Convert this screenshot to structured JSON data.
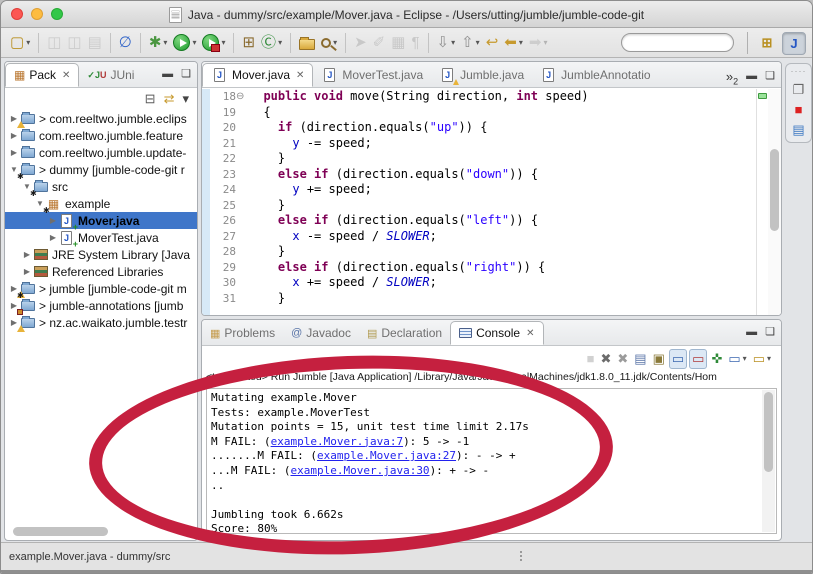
{
  "window": {
    "title": "Java - dummy/src/example/Mover.java - Eclipse - /Users/utting/jumble/jumble-code-git"
  },
  "toolbar": {
    "items": [
      {
        "name": "new-wizard",
        "glyph": "▢",
        "color": "#b99022",
        "dropdown": true
      },
      {
        "sep": true
      },
      {
        "name": "save",
        "glyph": "◫",
        "color": "#9a9a9a",
        "disabled": true
      },
      {
        "name": "save-all",
        "glyph": "◫",
        "color": "#9a9a9a",
        "disabled": true
      },
      {
        "name": "print",
        "glyph": "▤",
        "color": "#9a9a9a",
        "disabled": true
      },
      {
        "sep": true
      },
      {
        "name": "skip-all-breakpoints",
        "glyph": "∅",
        "color": "#3567c9"
      },
      {
        "sep": true
      },
      {
        "name": "debug",
        "glyph": "✱",
        "color": "#4a9640",
        "dropdown": true
      },
      {
        "name": "run",
        "kind": "run",
        "dropdown": true
      },
      {
        "name": "external-tools",
        "kind": "run-ext",
        "dropdown": true
      },
      {
        "sep": true
      },
      {
        "name": "new-java-project",
        "glyph": "⊞",
        "color": "#8a6b2f"
      },
      {
        "name": "new-java-class",
        "glyph": "Ⓒ",
        "color": "#2f8a38",
        "dropdown": true
      },
      {
        "sep": true
      },
      {
        "name": "open-task",
        "kind": "folder"
      },
      {
        "name": "search",
        "kind": "magnifier",
        "dropdown": true
      },
      {
        "sep": true
      },
      {
        "name": "run-last-tool",
        "glyph": "➤",
        "color": "#8f8f8f",
        "disabled": true
      },
      {
        "name": "format",
        "glyph": "✐",
        "color": "#8f8f8f",
        "disabled": true
      },
      {
        "name": "toggle-block-selection",
        "glyph": "▦",
        "color": "#8f8f8f",
        "disabled": true
      },
      {
        "name": "show-whitespace",
        "glyph": "¶",
        "color": "#8f8f8f",
        "disabled": true
      },
      {
        "sep": true
      },
      {
        "name": "next-annotation",
        "glyph": "⇩",
        "color": "#8f8f8f",
        "dropdown": true
      },
      {
        "name": "previous-annotation",
        "glyph": "⇧",
        "color": "#8f8f8f",
        "dropdown": true
      },
      {
        "name": "last-edit-location",
        "glyph": "↩",
        "color": "#c79a2e"
      },
      {
        "name": "back",
        "glyph": "⬅",
        "color": "#c79a2e",
        "dropdown": true
      },
      {
        "name": "forward",
        "glyph": "➡",
        "color": "#9f9f9f",
        "disabled": true,
        "dropdown": true
      }
    ]
  },
  "quick_access": {
    "value": "",
    "placeholder": ""
  },
  "perspective_bar": {
    "items": [
      {
        "name": "open-perspective",
        "glyph": "⊞",
        "color": "#b99022"
      },
      {
        "name": "java-perspective",
        "glyph": "J",
        "color": "#2456c4",
        "pressed": true
      }
    ]
  },
  "package_explorer": {
    "tabs": [
      {
        "label": "Pack",
        "icon": "package-explorer",
        "active": true,
        "closable": true
      },
      {
        "label": "JUni",
        "icon": "junit",
        "active": false
      }
    ],
    "toolbar": [
      {
        "name": "collapse-all",
        "glyph": "⊟",
        "color": "#5c5c5c"
      },
      {
        "name": "link-with-editor",
        "glyph": "⇄",
        "color": "#c79a2e"
      },
      {
        "name": "view-menu",
        "glyph": "▾",
        "color": "#444444"
      }
    ],
    "tree": [
      {
        "depth": 0,
        "arrow": "▶",
        "icon": "project-warning",
        "label": "> com.reeltwo.jumble.eclips"
      },
      {
        "depth": 0,
        "arrow": "▶",
        "icon": "folder",
        "label": "com.reeltwo.jumble.feature"
      },
      {
        "depth": 0,
        "arrow": "▶",
        "icon": "folder",
        "label": "com.reeltwo.jumble.update-"
      },
      {
        "depth": 0,
        "arrow": "▼",
        "icon": "project-star",
        "label": "> dummy  [jumble-code-git r"
      },
      {
        "depth": 1,
        "arrow": "▼",
        "icon": "src-folder",
        "label": "src"
      },
      {
        "depth": 2,
        "arrow": "▼",
        "icon": "package-star",
        "label": "example"
      },
      {
        "depth": 3,
        "arrow": "▶",
        "icon": "java-file-new",
        "label": "Mover.java",
        "selected": true
      },
      {
        "depth": 3,
        "arrow": "▶",
        "icon": "java-file-new",
        "label": "MoverTest.java"
      },
      {
        "depth": 1,
        "arrow": "▶",
        "icon": "library",
        "label": "JRE System Library [Java"
      },
      {
        "depth": 1,
        "arrow": "▶",
        "icon": "library",
        "label": "Referenced Libraries"
      },
      {
        "depth": 0,
        "arrow": "▶",
        "icon": "project-warning-star",
        "label": "> jumble  [jumble-code-git m"
      },
      {
        "depth": 0,
        "arrow": "▶",
        "icon": "project-error",
        "label": "> jumble-annotations  [jumb"
      },
      {
        "depth": 0,
        "arrow": "▶",
        "icon": "project-warning",
        "label": "> nz.ac.waikato.jumble.testr"
      }
    ]
  },
  "editor": {
    "tabs": [
      {
        "label": "Mover.java",
        "active": true,
        "closable": true
      },
      {
        "label": "MoverTest.java"
      },
      {
        "label": "Jumble.java",
        "warning": true
      },
      {
        "label": "JumbleAnnotatio"
      }
    ],
    "overflow": {
      "chevron": "»",
      "count": "2"
    },
    "lines": [
      {
        "num": "18",
        "fold": "⊖",
        "tokens": [
          [
            "pl",
            "  "
          ],
          [
            "kw",
            "public"
          ],
          [
            "pl",
            " "
          ],
          [
            "kw",
            "void"
          ],
          [
            "pl",
            " move(String direction, "
          ],
          [
            "kw",
            "int"
          ],
          [
            "pl",
            " speed)"
          ]
        ]
      },
      {
        "num": "19",
        "tokens": [
          [
            "pl",
            "  {"
          ]
        ]
      },
      {
        "num": "20",
        "tokens": [
          [
            "pl",
            "    "
          ],
          [
            "kw",
            "if"
          ],
          [
            "pl",
            " (direction.equals("
          ],
          [
            "st",
            "\"up\""
          ],
          [
            "pl",
            ")) {"
          ]
        ]
      },
      {
        "num": "21",
        "tokens": [
          [
            "pl",
            "      "
          ],
          [
            "fl",
            "y"
          ],
          [
            "pl",
            " -= speed;"
          ]
        ]
      },
      {
        "num": "22",
        "tokens": [
          [
            "pl",
            "    }"
          ]
        ]
      },
      {
        "num": "23",
        "tokens": [
          [
            "pl",
            "    "
          ],
          [
            "kw",
            "else"
          ],
          [
            "pl",
            " "
          ],
          [
            "kw",
            "if"
          ],
          [
            "pl",
            " (direction.equals("
          ],
          [
            "st",
            "\"down\""
          ],
          [
            "pl",
            ")) {"
          ]
        ]
      },
      {
        "num": "24",
        "tokens": [
          [
            "pl",
            "      "
          ],
          [
            "fl",
            "y"
          ],
          [
            "pl",
            " += speed;"
          ]
        ]
      },
      {
        "num": "25",
        "tokens": [
          [
            "pl",
            "    }"
          ]
        ]
      },
      {
        "num": "26",
        "tokens": [
          [
            "pl",
            "    "
          ],
          [
            "kw",
            "else"
          ],
          [
            "pl",
            " "
          ],
          [
            "kw",
            "if"
          ],
          [
            "pl",
            " (direction.equals("
          ],
          [
            "st",
            "\"left\""
          ],
          [
            "pl",
            ")) {"
          ]
        ]
      },
      {
        "num": "27",
        "tokens": [
          [
            "pl",
            "      "
          ],
          [
            "fl",
            "x"
          ],
          [
            "pl",
            " -= speed / "
          ],
          [
            "cn",
            "SLOWER"
          ],
          [
            "pl",
            ";"
          ]
        ]
      },
      {
        "num": "28",
        "tokens": [
          [
            "pl",
            "    }"
          ]
        ]
      },
      {
        "num": "29",
        "tokens": [
          [
            "pl",
            "    "
          ],
          [
            "kw",
            "else"
          ],
          [
            "pl",
            " "
          ],
          [
            "kw",
            "if"
          ],
          [
            "pl",
            " (direction.equals("
          ],
          [
            "st",
            "\"right\""
          ],
          [
            "pl",
            ")) {"
          ]
        ]
      },
      {
        "num": "30",
        "tokens": [
          [
            "pl",
            "      "
          ],
          [
            "fl",
            "x"
          ],
          [
            "pl",
            " += speed / "
          ],
          [
            "cn",
            "SLOWER"
          ],
          [
            "pl",
            ";"
          ]
        ]
      },
      {
        "num": "31",
        "tokens": [
          [
            "pl",
            "    }"
          ]
        ]
      }
    ]
  },
  "minimized_bar": {
    "items": [
      {
        "name": "restore-views",
        "glyph": "❐",
        "color": "#666666"
      },
      {
        "name": "jumble-view",
        "glyph": "■",
        "color": "#dd2222"
      },
      {
        "name": "outline-view",
        "glyph": "▤",
        "color": "#3b77c2"
      }
    ]
  },
  "console_panel": {
    "tabs": [
      {
        "label": "Problems",
        "icon": "problems"
      },
      {
        "label": "Javadoc",
        "icon": "javadoc"
      },
      {
        "label": "Declaration",
        "icon": "declaration"
      },
      {
        "label": "Console",
        "icon": "console",
        "active": true,
        "closable": true
      }
    ],
    "toolbar": [
      {
        "name": "terminate",
        "glyph": "■",
        "color": "#8f8f8f",
        "disabled": true
      },
      {
        "name": "remove-launch",
        "glyph": "✖",
        "color": "#6b6b6b"
      },
      {
        "name": "remove-all-terminated",
        "glyph": "✖",
        "color": "#9b9b9b"
      },
      {
        "name": "clear-console",
        "glyph": "▤",
        "color": "#5b76a8"
      },
      {
        "name": "scroll-lock",
        "glyph": "▣",
        "color": "#8a7a3a"
      },
      {
        "name": "show-stdout-when-changed",
        "glyph": "▭",
        "color": "#3b67b0",
        "pressed": true
      },
      {
        "name": "show-stderr-when-changed",
        "glyph": "▭",
        "color": "#b03a3a",
        "pressed": true
      },
      {
        "name": "pin-console",
        "glyph": "✜",
        "color": "#2f8a38"
      },
      {
        "name": "display-selected-console",
        "glyph": "▭",
        "color": "#3b67b0",
        "dropdown": true
      },
      {
        "name": "open-console",
        "glyph": "▭",
        "color": "#b99022",
        "dropdown": true
      }
    ],
    "header": "<terminated> Run Jumble [Java Application] /Library/Java/JavaVirtualMachines/jdk1.8.0_11.jdk/Contents/Hom",
    "lines": [
      [
        {
          "t": "Mutating example.Mover"
        }
      ],
      [
        {
          "t": "Tests: example.MoverTest"
        }
      ],
      [
        {
          "t": "Mutation points = 15, unit test time limit 2.17s"
        }
      ],
      [
        {
          "t": "M FAIL: ("
        },
        {
          "t": "example.Mover.java:7",
          "link": true
        },
        {
          "t": "): 5 -> -1"
        }
      ],
      [
        {
          "t": ".......M FAIL: ("
        },
        {
          "t": "example.Mover.java:27",
          "link": true
        },
        {
          "t": "): - -> +"
        }
      ],
      [
        {
          "t": "...M FAIL: ("
        },
        {
          "t": "example.Mover.java:30",
          "link": true
        },
        {
          "t": "): + -> -"
        }
      ],
      [
        {
          "t": ".."
        }
      ],
      [
        {
          "t": ""
        }
      ],
      [
        {
          "t": "Jumbling took 6.662s"
        }
      ],
      [
        {
          "t": "Score: 80%"
        }
      ]
    ]
  },
  "status_bar": {
    "left": "example.Mover.java - dummy/src"
  },
  "annotation": {
    "color": "#c5203f"
  }
}
